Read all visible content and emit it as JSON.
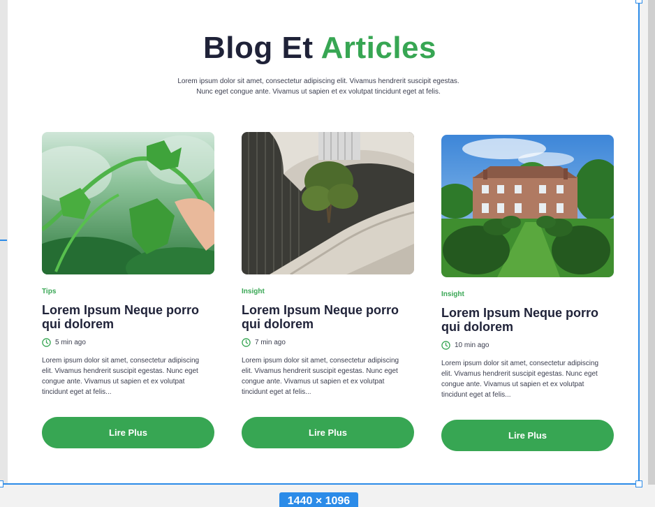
{
  "header": {
    "title_dark": "Blog Et",
    "title_accent": "Articles",
    "subtitle_line1": "Lorem ipsum dolor sit amet, consectetur adipiscing elit. Vivamus hendrerit suscipit egestas.",
    "subtitle_line2": "Nunc eget congue ante. Vivamus ut sapien et ex volutpat tincidunt eget at felis."
  },
  "cards": [
    {
      "image": "vine-plant-photo",
      "category": "Tips",
      "title": "Lorem Ipsum Neque porro qui dolorem",
      "time": "5 min ago",
      "excerpt": "Lorem ipsum dolor sit amet, consectetur adipiscing elit. Vivamus hendrerit suscipit egestas. Nunc eget congue ante. Vivamus ut sapien et ex volutpat tincidunt eget at felis...",
      "button": "Lire Plus"
    },
    {
      "image": "spiral-stair-tree-photo",
      "category": "Insight",
      "title": "Lorem Ipsum Neque porro qui dolorem",
      "time": "7 min ago",
      "excerpt": "Lorem ipsum dolor sit amet, consectetur adipiscing elit. Vivamus hendrerit suscipit egestas. Nunc eget congue ante. Vivamus ut sapien et ex volutpat tincidunt eget at felis...",
      "button": "Lire Plus"
    },
    {
      "image": "manor-garden-photo",
      "category": "Insight",
      "title": "Lorem Ipsum Neque porro qui dolorem",
      "time": "10 min ago",
      "excerpt": "Lorem ipsum dolor sit amet, consectetur adipiscing elit. Vivamus hendrerit suscipit egestas. Nunc eget congue ante. Vivamus ut sapien et ex volutpat tincidunt eget at felis...",
      "button": "Lire Plus"
    }
  ],
  "frame": {
    "size_label": "1440 × 1096"
  },
  "colors": {
    "accent": "#37a653",
    "dark": "#1f2238",
    "selection": "#2b8be8"
  }
}
